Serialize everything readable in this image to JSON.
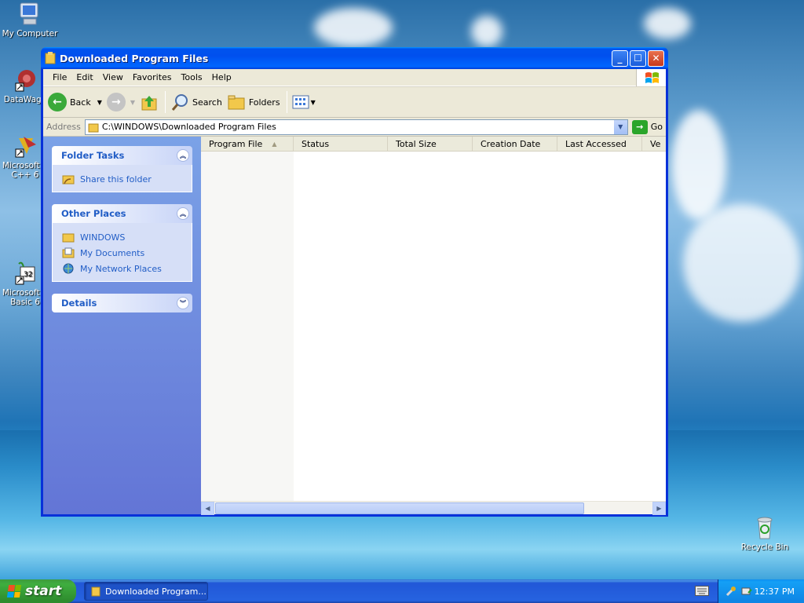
{
  "desktop": {
    "icons": [
      {
        "name": "my-computer-icon",
        "label": "My Computer"
      },
      {
        "name": "datawagon-icon",
        "label": "DataWago"
      },
      {
        "name": "microsoft-cpp-icon",
        "label": "Microsoft V",
        "label2": "C++ 6"
      },
      {
        "name": "microsoft-vb-icon",
        "label": "Microsoft V",
        "label2": "Basic 6"
      },
      {
        "name": "recycle-bin-icon",
        "label": "Recycle Bin"
      }
    ]
  },
  "window": {
    "title": "Downloaded Program Files",
    "menu": [
      "File",
      "Edit",
      "View",
      "Favorites",
      "Tools",
      "Help"
    ],
    "toolbar": {
      "back": "Back",
      "search": "Search",
      "folders": "Folders"
    },
    "address": {
      "label": "Address",
      "value": "C:\\WINDOWS\\Downloaded Program Files",
      "go": "Go"
    },
    "tasks": {
      "folder_tasks": {
        "title": "Folder Tasks",
        "items": [
          "Share this folder"
        ]
      },
      "other_places": {
        "title": "Other Places",
        "items": [
          "WINDOWS",
          "My Documents",
          "My Network Places"
        ]
      },
      "details": {
        "title": "Details"
      }
    },
    "columns": [
      "Program File",
      "Status",
      "Total Size",
      "Creation Date",
      "Last Accessed",
      "Ve"
    ]
  },
  "taskbar": {
    "start": "start",
    "task_item": "Downloaded Program...",
    "clock": "12:37 PM"
  },
  "colors": {
    "title_blue": "#0053ee",
    "link_blue": "#215dc6",
    "start_green": "#3fae3f"
  }
}
